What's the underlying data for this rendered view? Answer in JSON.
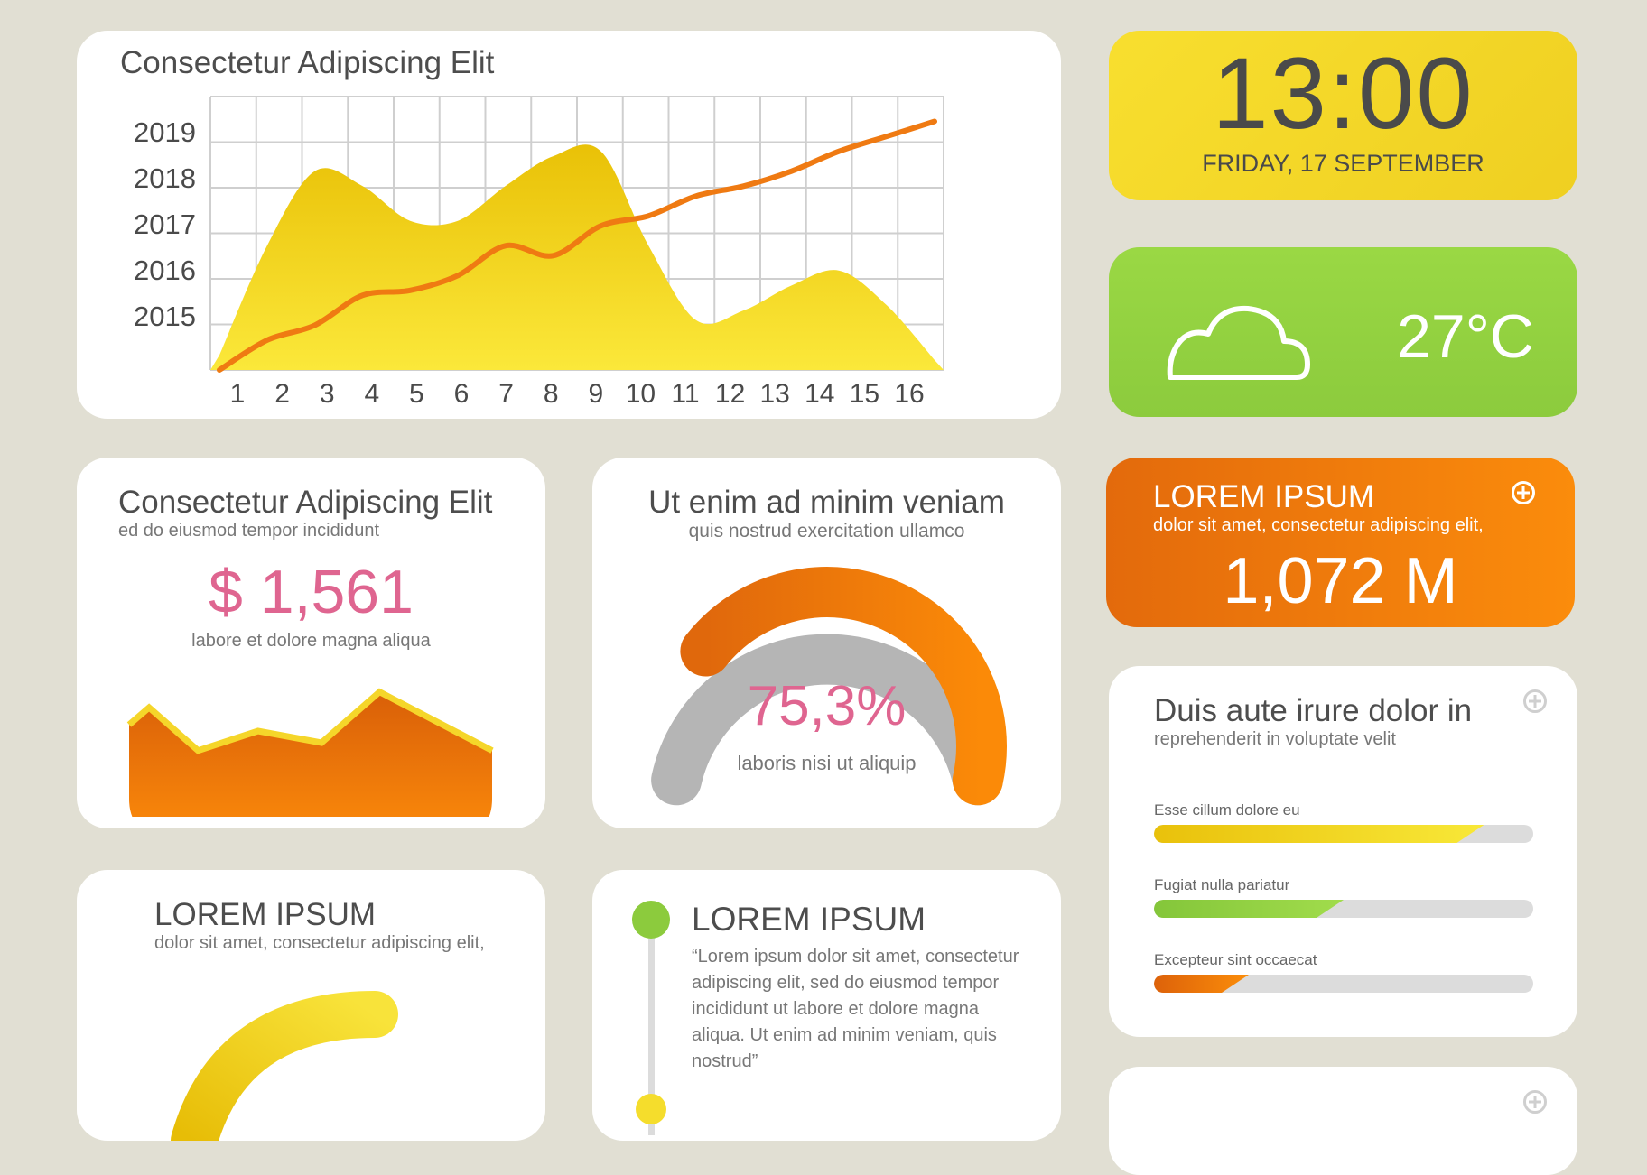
{
  "colors": {
    "background": "#e1dfd3",
    "yellow": "#f5dd2c",
    "green": "#93d341",
    "orange": "#ee7510",
    "pink": "#df6590",
    "gray": "#b5b5b5"
  },
  "main_chart": {
    "title": "Consectetur Adipiscing Elit",
    "y_labels": [
      "2019",
      "2018",
      "2017",
      "2016",
      "2015"
    ],
    "x_labels": [
      "1",
      "2",
      "3",
      "4",
      "5",
      "6",
      "7",
      "8",
      "9",
      "10",
      "11",
      "12",
      "13",
      "14",
      "15",
      "16"
    ]
  },
  "chart_data": [
    {
      "type": "area",
      "title": "Consectetur Adipiscing Elit",
      "categories": [
        "1",
        "2",
        "3",
        "4",
        "5",
        "6",
        "7",
        "8",
        "9",
        "10",
        "11",
        "12",
        "13",
        "14",
        "15",
        "16"
      ],
      "y_tick_labels": [
        "2015",
        "2016",
        "2017",
        "2018",
        "2019"
      ],
      "grid": true,
      "series": [
        {
          "values": [
            0.3,
            2.5,
            4.0,
            3.7,
            3.0,
            3.0,
            3.7,
            4.3,
            4.4,
            2.5,
            1.0,
            1.2,
            1.7,
            2.0,
            1.3,
            0.2
          ]
        },
        {
          "values": [
            0.0,
            0.6,
            0.9,
            1.5,
            1.6,
            1.9,
            2.5,
            2.3,
            2.9,
            3.1,
            3.5,
            3.7,
            4.0,
            4.4,
            4.7,
            5.0
          ]
        }
      ]
    },
    {
      "type": "area",
      "values": [
        2.1,
        1.0,
        1.5,
        1.2,
        2.5,
        1.0
      ],
      "ylim": [
        0,
        3
      ]
    },
    {
      "type": "pie",
      "value_label": "75,3%",
      "values": [
        75.3
      ]
    }
  ],
  "clock": {
    "time": "13:00",
    "date": "FRIDAY, 17 SEPTEMBER"
  },
  "weather": {
    "temperature": "27°C",
    "icon": "cloud-icon"
  },
  "stat_orange": {
    "title": "LOREM IPSUM",
    "subtitle": "dolor sit amet, consectetur adipiscing elit,",
    "value": "1,072 M",
    "icon": "plus-circle-icon"
  },
  "money_card": {
    "title": "Consectetur Adipiscing Elit",
    "subtitle": "ed do eiusmod tempor incididunt",
    "value": "$ 1,561",
    "caption": "labore et dolore magna aliqua"
  },
  "gauge_card": {
    "title": "Ut enim ad minim veniam",
    "subtitle": "quis nostrud exercitation ullamco",
    "value": "75,3%",
    "caption": "laboris nisi ut aliquip",
    "percent": 75.3
  },
  "progress_card": {
    "title": "Duis aute irure dolor in",
    "subtitle": "reprehenderit in voluptate velit",
    "icon": "plus-circle-icon",
    "bars": [
      {
        "label": "Esse cillum dolore eu",
        "percent": 87
      },
      {
        "label": "Fugiat nulla pariatur",
        "percent": 50
      },
      {
        "label": "Excepteur sint occaecat",
        "percent": 25
      }
    ]
  },
  "bottom_left": {
    "title": "LOREM IPSUM",
    "subtitle": "dolor sit amet, consectetur adipiscing elit,"
  },
  "bottom_mid": {
    "title": "LOREM IPSUM",
    "quote": "“Lorem ipsum dolor sit amet, consectetur adipiscing elit, sed do eiusmod tempor incididunt ut labore et dolore magna aliqua. Ut enim ad minim veniam, quis nostrud”"
  }
}
